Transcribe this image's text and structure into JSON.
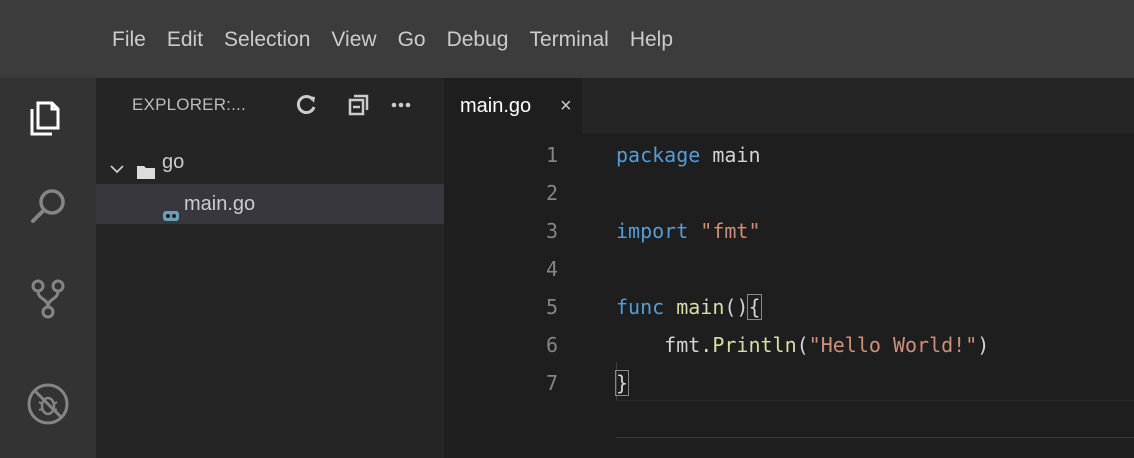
{
  "menubar": {
    "items": [
      "File",
      "Edit",
      "Selection",
      "View",
      "Go",
      "Debug",
      "Terminal",
      "Help"
    ]
  },
  "activitybar": {
    "icons": [
      "files-icon",
      "search-icon",
      "source-control-icon",
      "debug-icon"
    ]
  },
  "sidebar": {
    "title": "EXPLORER:...",
    "folder": "go",
    "file": "main.go"
  },
  "editor": {
    "tab_label": "main.go",
    "tab_close": "×",
    "lines": [
      {
        "num": "1"
      },
      {
        "num": "2"
      },
      {
        "num": "3"
      },
      {
        "num": "4"
      },
      {
        "num": "5"
      },
      {
        "num": "6"
      },
      {
        "num": "7"
      }
    ],
    "code": {
      "l1_kw": "package",
      "l1_rest": " main",
      "l3_kw": "import",
      "l3_str": " \"fmt\"",
      "l5_kw": "func",
      "l5_fn": " main",
      "l5_paren": "()",
      "l5_brace": "{",
      "l6_indent": "    fmt.",
      "l6_fn": "Println",
      "l6_open": "(",
      "l6_str": "\"Hello World!\"",
      "l6_close": ")",
      "l7_brace": "}"
    }
  },
  "colors": {
    "keyword": "#569cd6",
    "string": "#ce9178",
    "function": "#dcdcaa",
    "menubar_bg": "#3c3c3c",
    "sidebar_bg": "#252526",
    "editor_bg": "#1e1e1e"
  }
}
